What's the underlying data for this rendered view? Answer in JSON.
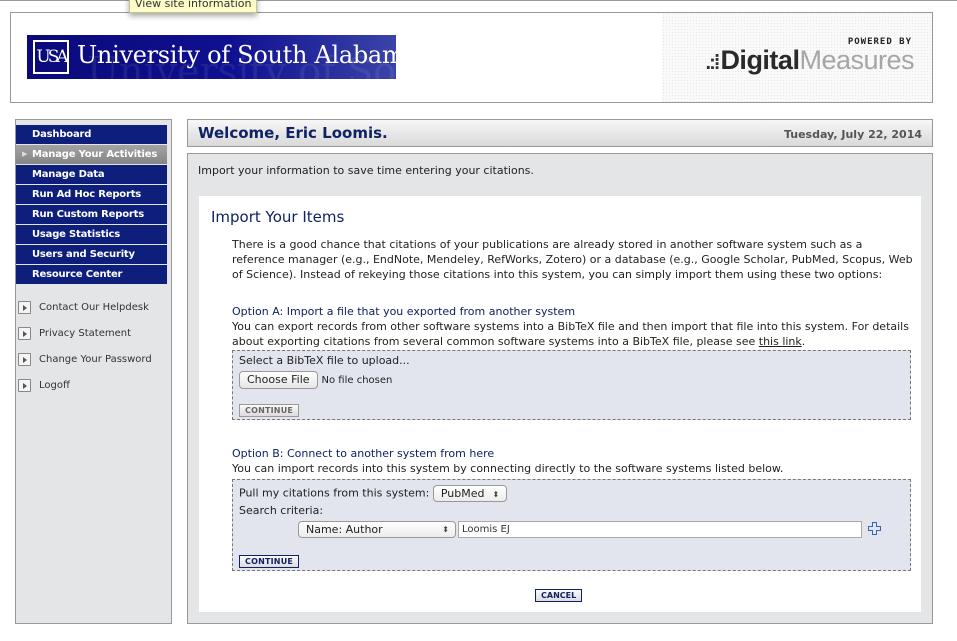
{
  "tooltip": "View site information",
  "header": {
    "university_name": "University of South Alabama",
    "university_mark": "USA",
    "powered_by": "POWERED BY",
    "vendor_part1": "Digital",
    "vendor_part2": "Measures"
  },
  "sidebar": {
    "nav_items": [
      {
        "label": "Dashboard",
        "active": false
      },
      {
        "label": "Manage Your Activities",
        "active": true
      },
      {
        "label": "Manage Data",
        "active": false
      },
      {
        "label": "Run Ad Hoc Reports",
        "active": false
      },
      {
        "label": "Run Custom Reports",
        "active": false
      },
      {
        "label": "Usage Statistics",
        "active": false
      },
      {
        "label": "Users and Security",
        "active": false
      },
      {
        "label": "Resource Center",
        "active": false
      }
    ],
    "links": [
      {
        "label": "Contact Our Helpdesk"
      },
      {
        "label": "Privacy Statement"
      },
      {
        "label": "Change Your Password"
      },
      {
        "label": "Logoff"
      }
    ]
  },
  "welcome": {
    "greeting": "Welcome, Eric Loomis.",
    "date": "Tuesday, July 22, 2014"
  },
  "main": {
    "intro": "Import your information to save time entering your citations.",
    "title": "Import Your Items",
    "description": "There is a good chance that citations of your publications are already stored in another software system such as a reference manager (e.g., EndNote, Mendeley, RefWorks, Zotero) or a database (e.g., Google Scholar, PubMed, Scopus, Web of Science). Instead of rekeying those citations into this system, you can simply import them using these two options:",
    "option_a": {
      "title": "Option A: Import a file that you exported from another system",
      "text": "You can export records from other software systems into a BibTeX file and then import that file into this system. For details about exporting citations from several common software systems into a BibTeX file, please see ",
      "link_text": "this link",
      "text_end": ".",
      "upload_label": "Select a BibTeX file to upload...",
      "choose_file_label": "Choose File",
      "file_status": "No file chosen",
      "continue_label": "CONTINUE"
    },
    "option_b": {
      "title": "Option B: Connect to another system from here",
      "text": "You can import records into this system by connecting directly to the software systems listed below.",
      "pull_label": "Pull my citations from this system:",
      "system_selected": "PubMed",
      "criteria_label": "Search criteria:",
      "field_selected": "Name: Author",
      "search_value": "Loomis EJ",
      "continue_label": "CONTINUE"
    },
    "cancel_label": "CANCEL"
  },
  "colors": {
    "nav_bg": "#0d1f7a",
    "heading": "#0e2264",
    "panel_bg": "#e4e5e7",
    "option_box_bg": "#e2e5ee"
  }
}
